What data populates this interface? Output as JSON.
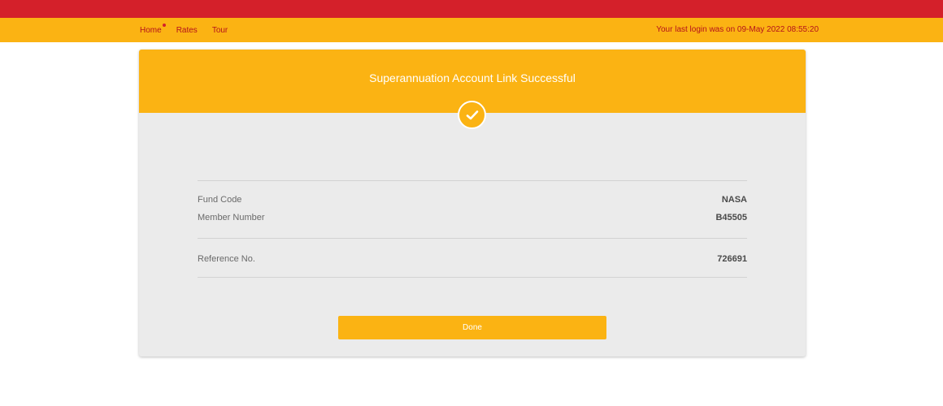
{
  "nav": {
    "items": [
      {
        "label": "Home"
      },
      {
        "label": "Rates"
      },
      {
        "label": "Tour"
      }
    ],
    "last_login": "Your last login was on 09-May 2022 08:55:20"
  },
  "card": {
    "title": "Superannuation Account Link Successful",
    "status_icon": "check-circle-icon",
    "fields": [
      {
        "label": "Fund Code",
        "value": "NASA"
      },
      {
        "label": "Member Number",
        "value": "B45505"
      }
    ],
    "reference": {
      "label": "Reference No.",
      "value": "726691"
    },
    "done_label": "Done"
  },
  "colors": {
    "brand_red": "#d4202a",
    "brand_yellow": "#fbb313",
    "card_bg": "#ebebeb"
  }
}
